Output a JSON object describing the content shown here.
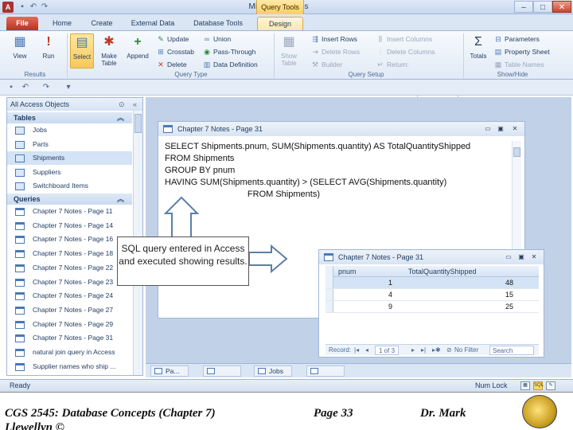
{
  "window": {
    "title": "Microsoft Access",
    "context_group": "Query Tools",
    "controls": [
      "–",
      "□",
      "✕"
    ]
  },
  "tabs": [
    {
      "label": "File"
    },
    {
      "label": "Home"
    },
    {
      "label": "Create"
    },
    {
      "label": "External Data"
    },
    {
      "label": "Database Tools"
    },
    {
      "label": "Design"
    }
  ],
  "ribbon": {
    "results": {
      "label": "Results",
      "view": "View",
      "run": "Run"
    },
    "query_type": {
      "label": "Query Type",
      "select": "Select",
      "make_table": "Make Table",
      "append": "Append",
      "update": "Update",
      "crosstab": "Crosstab",
      "delete": "Delete",
      "union": "Union",
      "pass_through": "Pass-Through",
      "data_definition": "Data Definition"
    },
    "query_setup": {
      "label": "Query Setup",
      "show_table": "Show Table",
      "insert_rows": "Insert Rows",
      "delete_rows": "Delete Rows",
      "builder": "Builder",
      "insert_columns": "Insert Columns",
      "delete_columns": "Delete Columns",
      "return": "Return:"
    },
    "show_hide": {
      "label": "Show/Hide",
      "totals": "Totals",
      "parameters": "Parameters",
      "property_sheet": "Property Sheet",
      "table_names": "Table Names"
    }
  },
  "nav": {
    "header": "All Access Objects",
    "tables_label": "Tables",
    "tables": [
      "Jobs",
      "Parts",
      "Shipments",
      "Suppliers",
      "Switchboard Items"
    ],
    "queries_label": "Queries",
    "queries": [
      "Chapter 7 Notes - Page 11",
      "Chapter 7 Notes - Page 14",
      "Chapter 7 Notes - Page 16",
      "Chapter 7 Notes - Page 18",
      "Chapter 7 Notes - Page 22",
      "Chapter 7 Notes - Page 23",
      "Chapter 7 Notes - Page 24",
      "Chapter 7 Notes - Page 27",
      "Chapter 7 Notes - Page 29",
      "Chapter 7 Notes - Page 31",
      "natural join query in Access",
      "Supplier names who ship ..."
    ]
  },
  "sql_window": {
    "title": "Chapter 7 Notes - Page 31",
    "sql_lines": [
      "SELECT Shipments.pnum, SUM(Shipments.quantity) AS TotalQuantityShipped",
      "FROM Shipments",
      "GROUP BY pnum",
      "HAVING SUM(Shipments.quantity) > (SELECT AVG(Shipments.quantity)",
      "                                  FROM Shipments)"
    ]
  },
  "result_window": {
    "title": "Chapter 7 Notes - Page 31",
    "columns": [
      "pnum",
      "TotalQuantityShipped"
    ],
    "rows": [
      [
        "1",
        "48"
      ],
      [
        "4",
        "15"
      ],
      [
        "9",
        "25"
      ]
    ],
    "nav_record": "Record: ",
    "nav_position": "1 of 3",
    "nav_filter": "No Filter",
    "nav_search": "Search"
  },
  "doc_tabs": [
    "Pa...",
    "",
    "Jobs",
    ""
  ],
  "status": {
    "text": "Ready",
    "numlock": "Num Lock",
    "sql_icon": "SQL"
  },
  "annotation": "SQL query entered in Access and executed showing results.",
  "footer": {
    "course": "CGS 2545: Database Concepts  (Chapter 7)",
    "page": "Page 33",
    "author": "Dr. Mark",
    "author_overflow": "Llewellyn ©"
  },
  "colors": {
    "accent_file_tab": "#c0392b",
    "context_tab": "#f7cf61",
    "selection": "#d4e3f6"
  }
}
